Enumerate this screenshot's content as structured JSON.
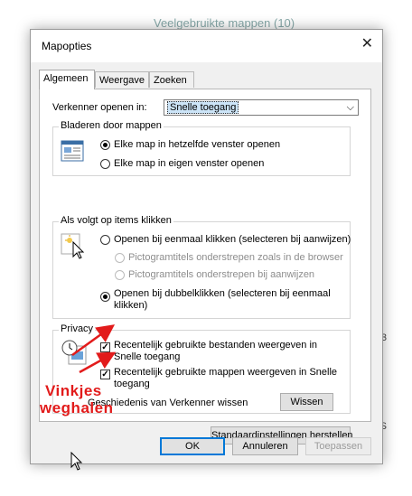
{
  "background": {
    "folder_title": "Veelgebruikte mappen (10)",
    "right_chars": [
      "3",
      "S"
    ]
  },
  "dialog": {
    "title": "Mapopties",
    "close_glyph": "✕"
  },
  "tabs": [
    {
      "label": "Algemeen"
    },
    {
      "label": "Weergave"
    },
    {
      "label": "Zoeken"
    }
  ],
  "open_explorer": {
    "label": "Verkenner openen in:",
    "value": "Snelle toegang"
  },
  "browse_group": {
    "title": "Bladeren door mappen",
    "options": [
      {
        "label": "Elke map in hetzelfde venster openen",
        "selected": true
      },
      {
        "label": "Elke map in eigen venster openen",
        "selected": false
      }
    ]
  },
  "click_group": {
    "title": "Als volgt op items klikken",
    "single": {
      "label": "Openen bij eenmaal klikken (selecteren bij aanwijzen)",
      "selected": false
    },
    "underline_browser": {
      "label": "Pictogramtitels onderstrepen zoals in de browser"
    },
    "underline_hover": {
      "label": "Pictogramtitels onderstrepen bij aanwijzen"
    },
    "double_line1": "Openen bij dubbelklikken (selecteren bij eenmaal",
    "double_line2": "klikken)"
  },
  "privacy_group": {
    "title": "Privacy",
    "recent_files_line1": "Recentelijk gebruikte bestanden weergeven in",
    "recent_files_line2": "Snelle toegang",
    "recent_folders_line1": "Recentelijk gebruikte mappen weergeven in Snelle",
    "recent_folders_line2": "toegang",
    "clear_label": "Geschiedenis van Verkenner wissen",
    "clear_button": "Wissen"
  },
  "restore_defaults_button": "Standaardinstellingen herstellen",
  "footer": {
    "ok": "OK",
    "cancel": "Annuleren",
    "apply": "Toepassen"
  },
  "annotation": {
    "line1": "Vinkjes",
    "line2": "weghalen",
    "color": "#e21b1b"
  }
}
